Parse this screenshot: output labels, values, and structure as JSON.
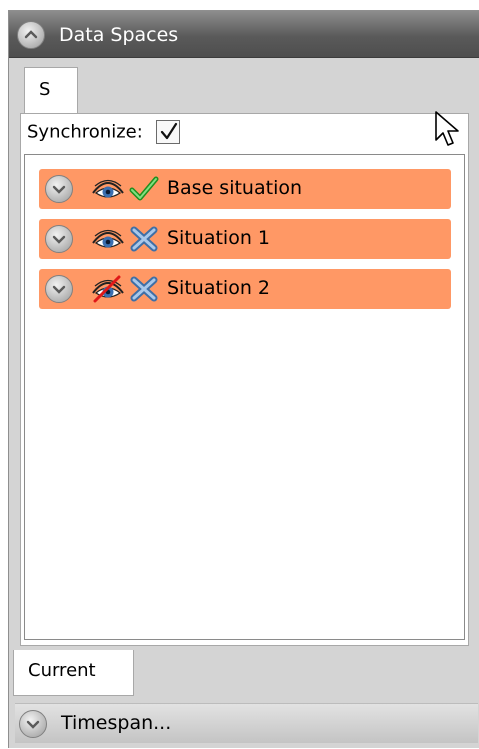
{
  "panel": {
    "title": "Data Spaces"
  },
  "tabs": {
    "top_tab_label": "S",
    "bottom_tab_label": "Current"
  },
  "sync": {
    "label": "Synchronize:",
    "checked": true
  },
  "situations": [
    {
      "label": "Base situation",
      "visible": true,
      "status": "check"
    },
    {
      "label": "Situation 1",
      "visible": true,
      "status": "cross"
    },
    {
      "label": "Situation 2",
      "visible": false,
      "status": "cross"
    }
  ],
  "timespan": {
    "label": "Timespan..."
  },
  "colors": {
    "item_background": "#ff9865",
    "header_background": "#5a5a5a",
    "check_green": "#2fb52f",
    "cross_blue": "#5e8fc4"
  }
}
